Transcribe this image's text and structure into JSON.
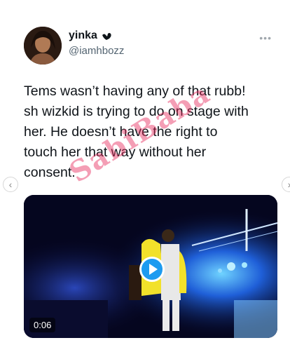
{
  "tweet": {
    "display_name": "yinka",
    "handle": "@iamhbozz",
    "text": "Tems wasn’t having any of that rubb!\nsh wizkid is trying to do on stage with\nher. He doesn’t have the right to\ntouch her that way without her\nconsent."
  },
  "watermark": {
    "text": "SabiBaba"
  },
  "media": {
    "duration": "0:06"
  },
  "icons": {
    "verified": "verified-badge-icon",
    "more": "more-options-icon",
    "play": "play-icon",
    "prev": "chevron-left-icon",
    "next": "chevron-right-icon"
  },
  "colors": {
    "accent": "#1d9bf0",
    "text": "#0f1419",
    "secondary": "#536471",
    "watermark": "#e6285a"
  }
}
